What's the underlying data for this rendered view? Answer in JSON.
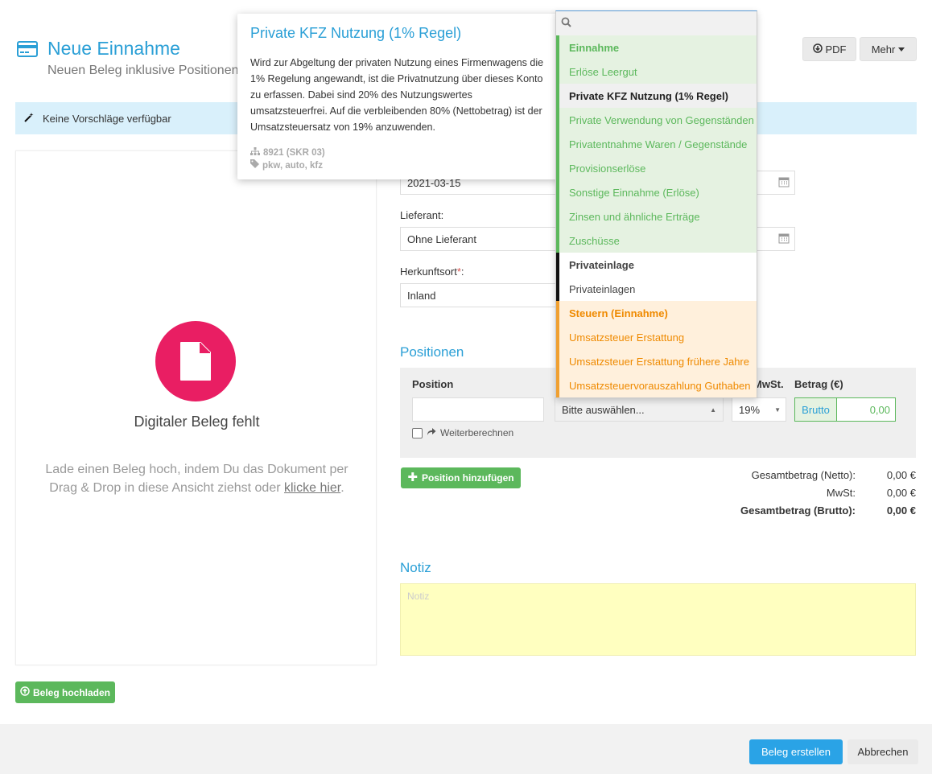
{
  "header": {
    "title": "Neue Einnahme",
    "subtitle": "Neuen Beleg inklusive Positionen",
    "pdf_label": "PDF",
    "more_label": "Mehr"
  },
  "alert": {
    "text": "Keine Vorschläge verfügbar"
  },
  "upload": {
    "title": "Digitaler Beleg fehlt",
    "desc_prefix": "Lade einen Beleg hoch, indem Du das Dokument per Drag & Drop in diese Ansicht ziehst oder ",
    "link": "klicke hier",
    "desc_suffix": ".",
    "upload_button": "Beleg hochladen"
  },
  "form": {
    "date_value": "2021-03-15",
    "supplier_label": "Lieferant:",
    "supplier_value": "Ohne Lieferant",
    "origin_label": "Herkunftsort",
    "origin_required": "*",
    "origin_colon": ":",
    "origin_value": "Inland"
  },
  "positions": {
    "section_title": "Positionen",
    "col_position": "Position",
    "col_mwst": "MwSt.",
    "col_betrag": "Betrag (€)",
    "category_placeholder": "Bitte auswählen...",
    "vat_value": "19%",
    "brutto_label": "Brutto",
    "amount_value": "0,00",
    "recalc_label": "Weiterberechnen",
    "add_button": "Position hinzufügen"
  },
  "totals": {
    "net_label": "Gesamtbetrag (Netto):",
    "net_value": "0,00 €",
    "vat_label": "MwSt:",
    "vat_value": "0,00 €",
    "gross_label": "Gesamtbetrag (Brutto):",
    "gross_value": "0,00 €"
  },
  "notes": {
    "section_title": "Notiz",
    "placeholder": "Notiz"
  },
  "footer": {
    "create_button": "Beleg erstellen",
    "cancel_button": "Abbrechen"
  },
  "popover": {
    "title": "Private KFZ Nutzung (1% Regel)",
    "body": "Wird zur Abgeltung der privaten Nutzung eines Firmenwagens die 1% Regelung angewandt, ist die Privatnutzung über dieses Konto zu erfassen. Dabei sind 20% des Nutzungswertes umsatzsteuerfrei. Auf die verbleibenden 80% (Nettobetrag) ist der Umsatzsteuersatz von 19% anzuwenden.",
    "account": "8921 (SKR 03)",
    "tags": "pkw, auto, kfz"
  },
  "dropdown": {
    "items": [
      {
        "label": "Einnahme",
        "kind": "green-hdr"
      },
      {
        "label": "Erlöse Leergut",
        "kind": "green"
      },
      {
        "label": "Private KFZ Nutzung (1% Regel)",
        "kind": "active"
      },
      {
        "label": "Private Verwendung von Gegenständen",
        "kind": "green"
      },
      {
        "label": "Privatentnahme Waren / Gegenstände",
        "kind": "green"
      },
      {
        "label": "Provisionserlöse",
        "kind": "green"
      },
      {
        "label": "Sonstige Einnahme (Erlöse)",
        "kind": "green"
      },
      {
        "label": "Zinsen und ähnliche Erträge",
        "kind": "green"
      },
      {
        "label": "Zuschüsse",
        "kind": "green"
      },
      {
        "label": "Privateinlage",
        "kind": "black-hdr"
      },
      {
        "label": "Privateinlagen",
        "kind": "black"
      },
      {
        "label": "Steuern (Einnahme)",
        "kind": "orange-hdr"
      },
      {
        "label": "Umsatzsteuer Erstattung",
        "kind": "orange"
      },
      {
        "label": "Umsatzsteuer Erstattung frühere Jahre",
        "kind": "orange"
      },
      {
        "label": "Umsatzsteuervorauszahlung Guthaben",
        "kind": "orange"
      }
    ]
  },
  "colors": {
    "accent": "#2a9fd6",
    "green": "#5cb85c",
    "pink": "#e91e63",
    "orange": "#ef8a00"
  }
}
